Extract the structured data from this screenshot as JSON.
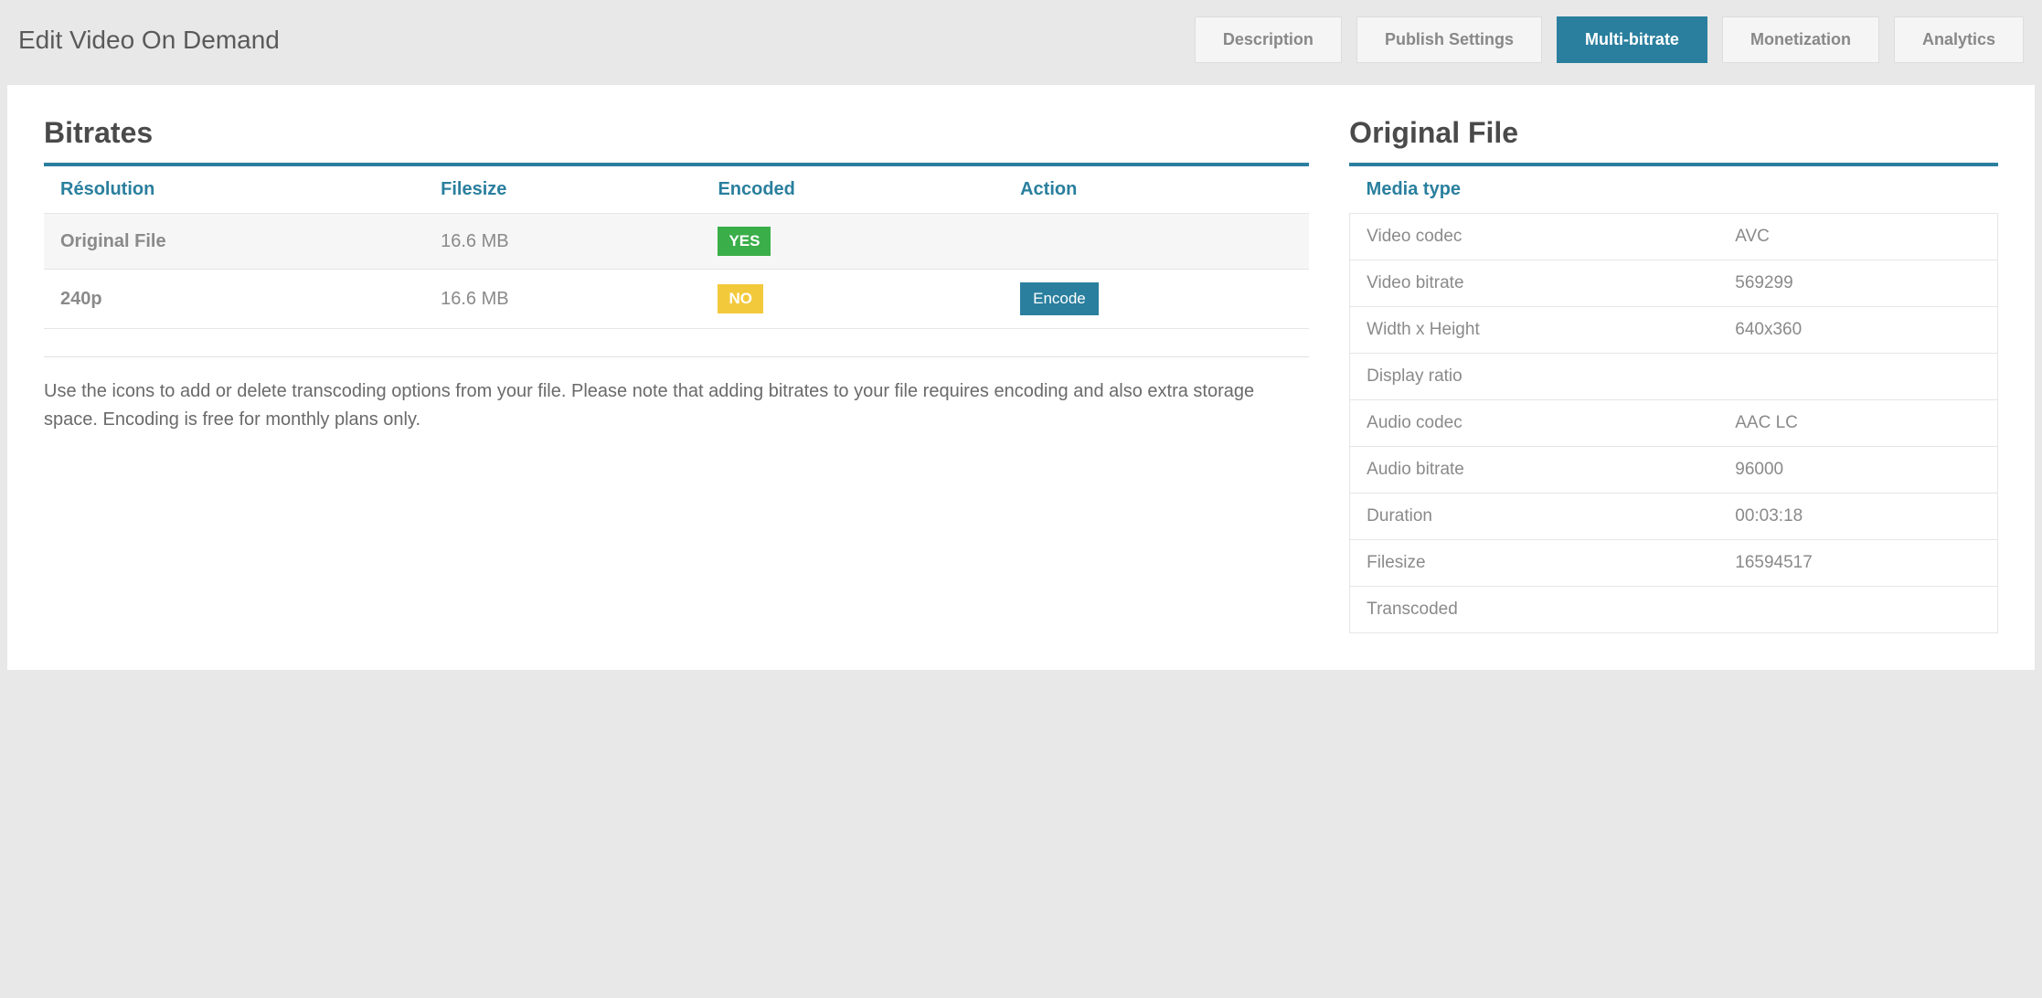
{
  "page_title": "Edit Video On Demand",
  "tabs": [
    {
      "label": "Description",
      "active": false
    },
    {
      "label": "Publish Settings",
      "active": false
    },
    {
      "label": "Multi-bitrate",
      "active": true
    },
    {
      "label": "Monetization",
      "active": false
    },
    {
      "label": "Analytics",
      "active": false
    }
  ],
  "bitrates": {
    "heading": "Bitrates",
    "columns": {
      "resolution": "Résolution",
      "filesize": "Filesize",
      "encoded": "Encoded",
      "action": "Action"
    },
    "rows": [
      {
        "resolution": "Original File",
        "filesize": "16.6 MB",
        "encoded": "YES",
        "action": ""
      },
      {
        "resolution": "240p",
        "filesize": "16.6 MB",
        "encoded": "NO",
        "action": "Encode"
      }
    ],
    "note": "Use the icons to add or delete transcoding options from your file. Please note that adding bitrates to your file requires encoding and also extra storage space. Encoding is free for monthly plans only."
  },
  "original_file": {
    "heading": "Original File",
    "header": "Media type",
    "rows": [
      {
        "label": "Video codec",
        "value": "AVC"
      },
      {
        "label": "Video bitrate",
        "value": "569299"
      },
      {
        "label": "Width x Height",
        "value": "640x360"
      },
      {
        "label": "Display ratio",
        "value": ""
      },
      {
        "label": "Audio codec",
        "value": "AAC LC"
      },
      {
        "label": "Audio bitrate",
        "value": "96000"
      },
      {
        "label": "Duration",
        "value": "00:03:18"
      },
      {
        "label": "Filesize",
        "value": "16594517"
      },
      {
        "label": "Transcoded",
        "value": ""
      }
    ]
  }
}
